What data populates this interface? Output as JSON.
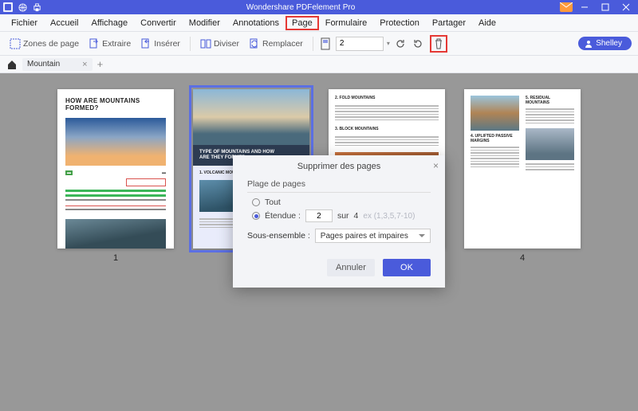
{
  "app": {
    "title": "Wondershare PDFelement Pro"
  },
  "menus": {
    "file": "Fichier",
    "home": "Accueil",
    "view": "Affichage",
    "convert": "Convertir",
    "edit": "Modifier",
    "annotate": "Annotations",
    "page": "Page",
    "form": "Formulaire",
    "protect": "Protection",
    "share": "Partager",
    "help": "Aide"
  },
  "toolbar": {
    "page_zones": "Zones de page",
    "extract": "Extraire",
    "insert": "Insérer",
    "split": "Diviser",
    "replace": "Remplacer",
    "page_value": "2",
    "user_label": "Shelley"
  },
  "tabs": {
    "doc1": "Mountain"
  },
  "thumbs": {
    "p1_title": "HOW ARE MOUNTAINS FORMED?",
    "p2_band_l1": "TYPE OF MOUNTAINS AND HOW",
    "p2_band_l2": "ARE THEY FORMED",
    "p2_sec": "1. VOLCANIC MOUNTAINS",
    "p3_sec1": "2. FOLD MOUNTAINS",
    "p3_sec2": "3. BLOCK MOUNTAINS",
    "p4_sec1": "4. UPLIFTED PASSIVE MARGINS",
    "p4_sec2": "5. RESIDUAL MOUNTAINS",
    "num1": "1",
    "num4": "4"
  },
  "dialog": {
    "title": "Supprimer des pages",
    "group_label": "Plage de pages",
    "radio_all": "Tout",
    "radio_range": "Étendue :",
    "range_value": "2",
    "range_mid": "sur",
    "range_total": "4",
    "range_hint": "ex (1,3,5,7-10)",
    "subset_label": "Sous-ensemble :",
    "subset_value": "Pages paires et impaires",
    "btn_cancel": "Annuler",
    "btn_ok": "OK"
  }
}
